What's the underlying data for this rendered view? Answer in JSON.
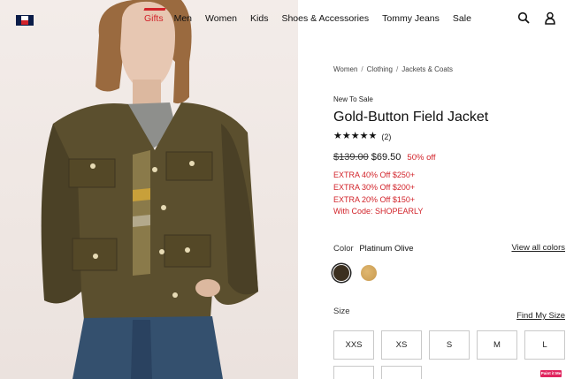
{
  "header": {
    "nav": [
      {
        "label": "Gifts"
      },
      {
        "label": "Men"
      },
      {
        "label": "Women"
      },
      {
        "label": "Kids"
      },
      {
        "label": "Shoes & Accessories"
      },
      {
        "label": "Tommy Jeans"
      },
      {
        "label": "Sale"
      }
    ],
    "icons": [
      "search-icon",
      "account-icon"
    ]
  },
  "product": {
    "breadcrumb": [
      "Women",
      "Clothing",
      "Jackets & Coats"
    ],
    "tag": "New To Sale",
    "title": "Gold-Button Field Jacket",
    "rating": {
      "stars": 5,
      "count_label": "(2)"
    },
    "price": {
      "original": "$139.00",
      "sale": "$69.50",
      "discount": "50% off"
    },
    "promos": [
      "EXTRA 40% Off $250+",
      "EXTRA 30% Off $200+",
      "EXTRA 20% Off $150+",
      "With Code: SHOPEARLY"
    ],
    "color": {
      "label": "Color",
      "selected": "Platinum Olive",
      "view_all": "View all colors",
      "swatches": [
        "#3b2f1f",
        "#d4a95f"
      ]
    },
    "size": {
      "label": "Size",
      "guide": "Find My Size",
      "options": [
        "XXS",
        "XS",
        "S",
        "M",
        "L"
      ]
    }
  },
  "badge": "Paint it Me",
  "colors": {
    "accent": "#d2232a",
    "text": "#111111"
  }
}
